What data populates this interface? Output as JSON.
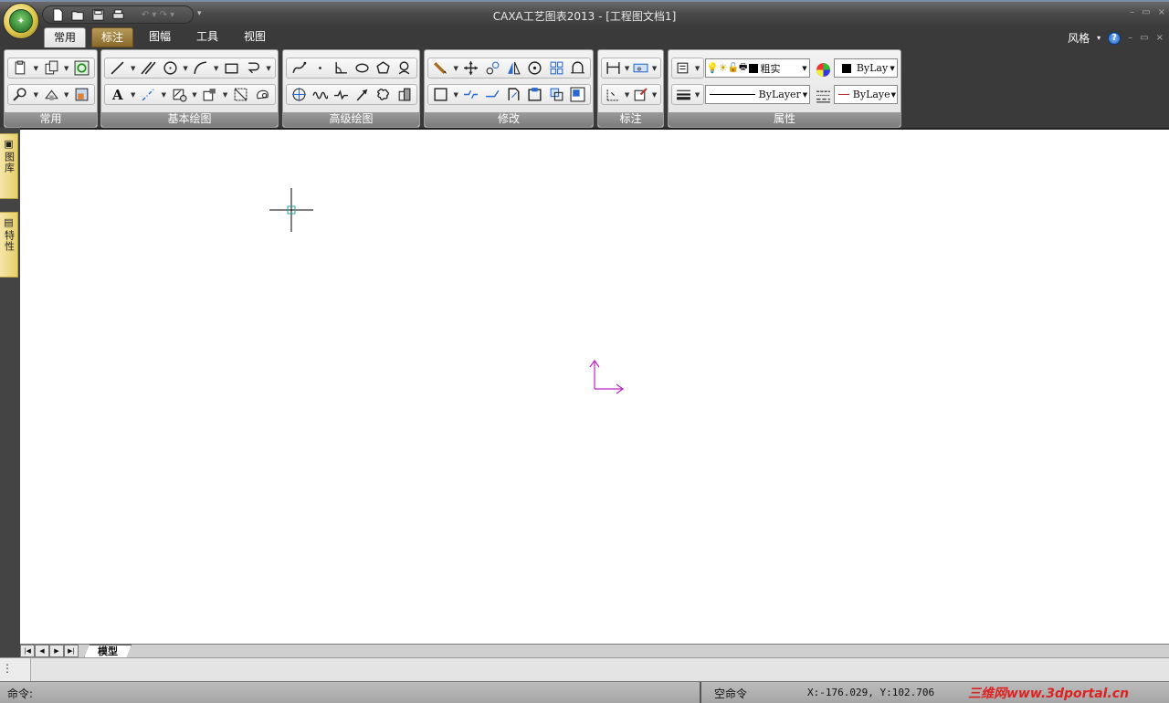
{
  "window": {
    "title": "CAXA工艺图表2013 - [工程图文档1]",
    "controls": [
      "–",
      "▭",
      "×"
    ]
  },
  "quick_access": {
    "more_label": "▾"
  },
  "ribbon": {
    "tabs": [
      {
        "label": "常用",
        "state": "active"
      },
      {
        "label": "标注",
        "state": "hover"
      },
      {
        "label": "图幅",
        "state": ""
      },
      {
        "label": "工具",
        "state": ""
      },
      {
        "label": "视图",
        "state": ""
      }
    ],
    "style_label": "风格",
    "help_label": "?",
    "groups": {
      "common": "常用",
      "basic_draw": "基本绘图",
      "advanced_draw": "高级绘图",
      "modify": "修改",
      "annotate": "标注",
      "properties": "属性"
    },
    "layer_value": "粗实",
    "color_value": "ByLay",
    "linetype_value": "ByLayer",
    "lineweight_value": "ByLaye"
  },
  "sidebar": {
    "tab1_label": "图库",
    "tab2_label": "特性"
  },
  "layout": {
    "model_tab": "模型"
  },
  "status": {
    "command_label": "命令:",
    "state_text": "空命令",
    "coords": "X:-176.029, Y:102.706",
    "watermark": "三维网www.3dportal.cn"
  },
  "colors": {
    "ucs": "#c020c0",
    "cursor_box": "#20a0a0"
  }
}
